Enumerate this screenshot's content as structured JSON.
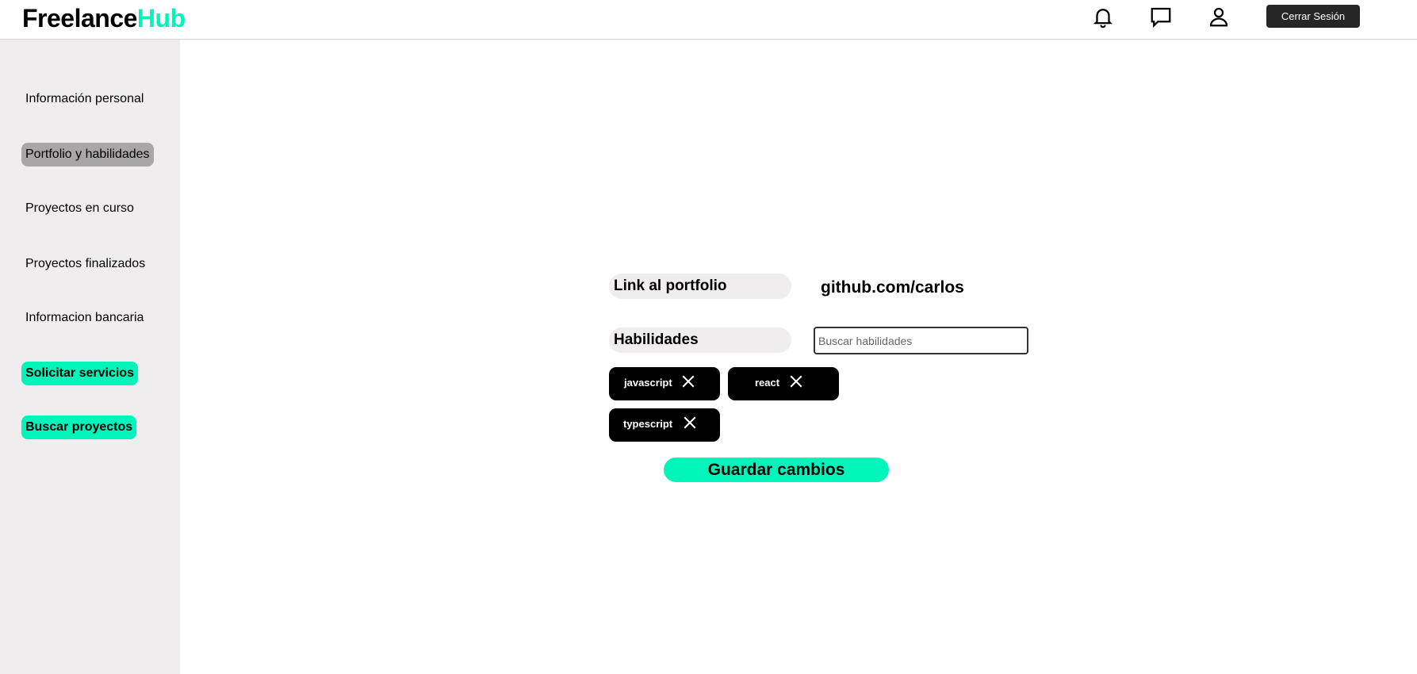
{
  "header": {
    "logo_part1": "Freelance",
    "logo_part2": "Hub",
    "logout_label": "Cerrar Sesión"
  },
  "sidebar": {
    "items": [
      {
        "label": "Información personal"
      },
      {
        "label": "Portfolio y habilidades"
      },
      {
        "label": "Proyectos en curso"
      },
      {
        "label": "Proyectos finalizados"
      },
      {
        "label": "Informacion bancaria"
      },
      {
        "label": "Solicitar servicios"
      },
      {
        "label": "Buscar proyectos"
      }
    ]
  },
  "main": {
    "portfolio_label": "Link al portfolio",
    "portfolio_value": "github.com/carlos",
    "skills_label": "Habilidades",
    "skills_placeholder": "Buscar habilidades",
    "skills": [
      "javascript",
      "react",
      "typescript"
    ],
    "save_label": "Guardar cambios"
  },
  "colors": {
    "accent": "#00f5bb",
    "sidebar_bg": "#efeded",
    "active_item": "#a8a6a6"
  }
}
